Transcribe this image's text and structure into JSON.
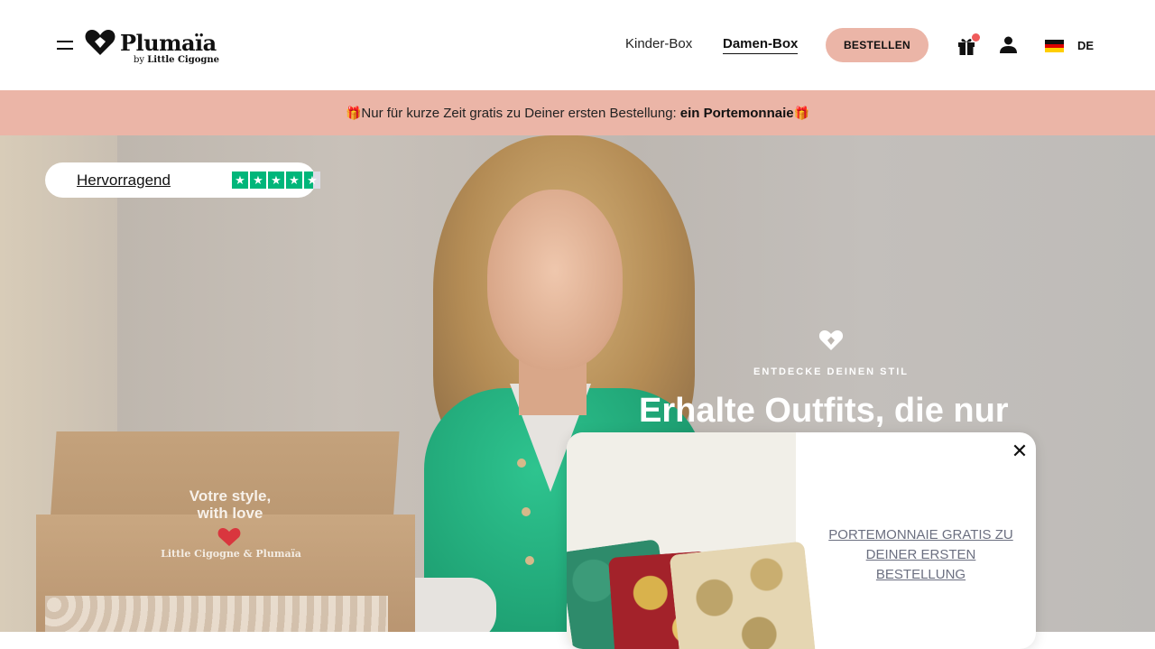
{
  "header": {
    "menu_icon": "hamburger-icon",
    "logo": {
      "name": "Plumaïa",
      "sub_prefix": "by",
      "sub_brand": "Little Cigogne"
    },
    "nav": [
      {
        "label": "Kinder-Box",
        "active": false
      },
      {
        "label": "Damen-Box",
        "active": true
      }
    ],
    "order_button": "BESTELLEN",
    "icons": [
      "gift-icon",
      "user-icon"
    ],
    "language": "DE",
    "accent_color": "#ebb5a7"
  },
  "promo": {
    "text": "Nur für kurze Zeit gratis zu Deiner ersten Bestellung:",
    "highlight": "ein Portemonnaie",
    "icon": "gift-emoji"
  },
  "hero": {
    "trustpilot": {
      "label": "Hervorragend",
      "stars": 4.5,
      "color": "#00b67a"
    },
    "box_text": "Votre style,\nwith love",
    "box_brand": "Little Cigogne & Plumaïa",
    "kicker": "ENTDECKE DEINEN STIL",
    "title": "Erhalte Outfits, die nur"
  },
  "popup": {
    "text": "PORTEMONNAIE GRATIS ZU DEINER ERSTEN BESTELLUNG",
    "close_icon": "close-icon"
  }
}
